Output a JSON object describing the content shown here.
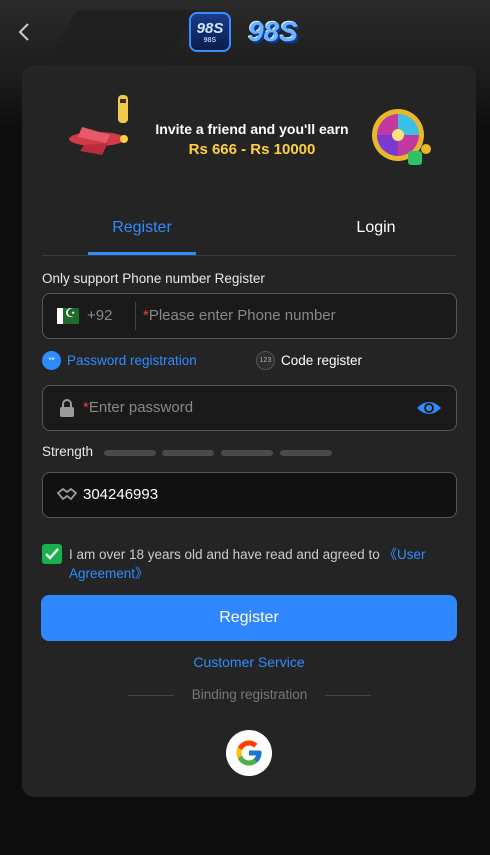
{
  "header": {
    "logo_text": "98S",
    "logo_sub": "98S"
  },
  "banner": {
    "line1": "Invite a friend and you'll earn",
    "line2": "Rs 666 - Rs 10000"
  },
  "tabs": [
    {
      "label": "Register",
      "active": true
    },
    {
      "label": "Login",
      "active": false
    }
  ],
  "hint": "Only support Phone number Register",
  "phone": {
    "country_code": "+92",
    "required_mark": "*",
    "placeholder": "Please enter Phone number"
  },
  "modes": {
    "password_label": "Password registration",
    "password_dot": "**",
    "code_label": "Code register",
    "code_dot": "123"
  },
  "password": {
    "required_mark": "*",
    "placeholder": "Enter password"
  },
  "strength_label": "Strength",
  "invite_code": "304246993",
  "agreement": {
    "text": "I am over 18 years old and have read and agreed to ",
    "link": "《User Agreement》",
    "checked": true
  },
  "register_button": "Register",
  "customer_service": "Customer Service",
  "binding_label": "Binding registration",
  "colors": {
    "accent": "#2f87ff",
    "check": "#19b14a",
    "amount": "#ffcf3f"
  }
}
